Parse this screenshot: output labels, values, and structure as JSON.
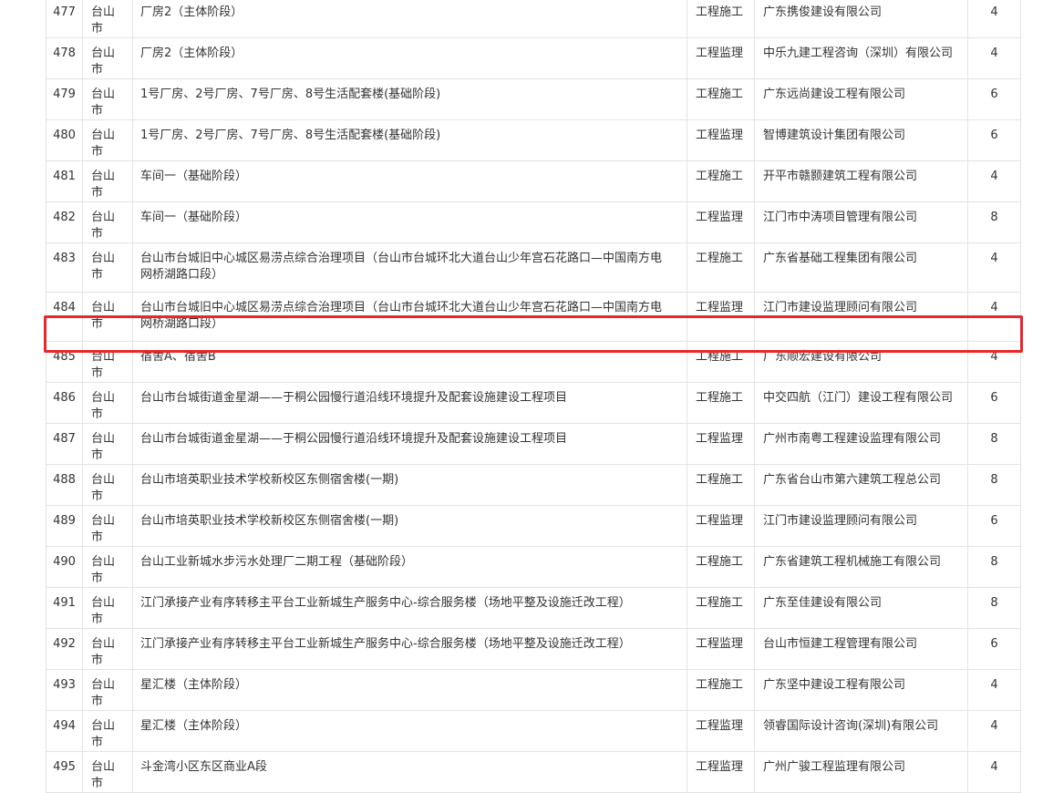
{
  "table": {
    "highlight_color": "#e8262b",
    "rows": [
      {
        "no": "477",
        "city": "台山市",
        "project": "厂房2（主体阶段）",
        "type": "工程施工",
        "company": "广东携俊建设有限公司",
        "score": "4"
      },
      {
        "no": "478",
        "city": "台山市",
        "project": "厂房2（主体阶段）",
        "type": "工程监理",
        "company": "中乐九建工程咨询（深圳）有限公司",
        "score": "4"
      },
      {
        "no": "479",
        "city": "台山市",
        "project": "1号厂房、2号厂房、7号厂房、8号生活配套楼(基础阶段)",
        "type": "工程施工",
        "company": "广东远尚建设工程有限公司",
        "score": "6"
      },
      {
        "no": "480",
        "city": "台山市",
        "project": "1号厂房、2号厂房、7号厂房、8号生活配套楼(基础阶段)",
        "type": "工程监理",
        "company": "智博建筑设计集团有限公司",
        "score": "6"
      },
      {
        "no": "481",
        "city": "台山市",
        "project": "车间一（基础阶段）",
        "type": "工程施工",
        "company": "开平市赣颢建筑工程有限公司",
        "score": "4"
      },
      {
        "no": "482",
        "city": "台山市",
        "project": "车间一（基础阶段）",
        "type": "工程监理",
        "company": "江门市中涛项目管理有限公司",
        "score": "8"
      },
      {
        "no": "483",
        "city": "台山市",
        "project": "台山市台城旧中心城区易涝点综合治理项目（台山市台城环北大道台山少年宫石花路口—中国南方电网桥湖路口段）",
        "type": "工程施工",
        "company": "广东省基础工程集团有限公司",
        "score": "4"
      },
      {
        "no": "484",
        "city": "台山市",
        "project": "台山市台城旧中心城区易涝点综合治理项目（台山市台城环北大道台山少年宫石花路口—中国南方电网桥湖路口段）",
        "type": "工程监理",
        "company": "江门市建设监理顾问有限公司",
        "score": "4"
      },
      {
        "no": "485",
        "city": "台山市",
        "project": "宿舍A、宿舍B",
        "type": "工程施工",
        "company": "广东顺宏建设有限公司",
        "score": "4"
      },
      {
        "no": "486",
        "city": "台山市",
        "project": "台山市台城街道金星湖——于桐公园慢行道沿线环境提升及配套设施建设工程项目",
        "type": "工程施工",
        "company": "中交四航（江门）建设工程有限公司",
        "score": "6"
      },
      {
        "no": "487",
        "city": "台山市",
        "project": "台山市台城街道金星湖——于桐公园慢行道沿线环境提升及配套设施建设工程项目",
        "type": "工程监理",
        "company": "广州市南粤工程建设监理有限公司",
        "score": "8"
      },
      {
        "no": "488",
        "city": "台山市",
        "project": "台山市培英职业技术学校新校区东侧宿舍楼(一期)",
        "type": "工程施工",
        "company": "广东省台山市第六建筑工程总公司",
        "score": "8"
      },
      {
        "no": "489",
        "city": "台山市",
        "project": "台山市培英职业技术学校新校区东侧宿舍楼(一期)",
        "type": "工程监理",
        "company": "江门市建设监理顾问有限公司",
        "score": "6"
      },
      {
        "no": "490",
        "city": "台山市",
        "project": "台山工业新城水步污水处理厂二期工程（基础阶段）",
        "type": "工程施工",
        "company": "广东省建筑工程机械施工有限公司",
        "score": "8"
      },
      {
        "no": "491",
        "city": "台山市",
        "project": "江门承接产业有序转移主平台工业新城生产服务中心-综合服务楼（场地平整及设施迁改工程）",
        "type": "工程施工",
        "company": "广东至佳建设有限公司",
        "score": "8"
      },
      {
        "no": "492",
        "city": "台山市",
        "project": "江门承接产业有序转移主平台工业新城生产服务中心-综合服务楼（场地平整及设施迁改工程）",
        "type": "工程监理",
        "company": "台山市恒建工程管理有限公司",
        "score": "6"
      },
      {
        "no": "493",
        "city": "台山市",
        "project": "星汇楼（主体阶段）",
        "type": "工程施工",
        "company": "广东坚中建设工程有限公司",
        "score": "4"
      },
      {
        "no": "494",
        "city": "台山市",
        "project": "星汇楼（主体阶段）",
        "type": "工程监理",
        "company": "领睿国际设计咨询(深圳)有限公司",
        "score": "4"
      },
      {
        "no": "495",
        "city": "台山市",
        "project": "斗金湾小区东区商业A段",
        "type": "工程监理",
        "company": "广州广骏工程监理有限公司",
        "score": "4"
      }
    ]
  }
}
